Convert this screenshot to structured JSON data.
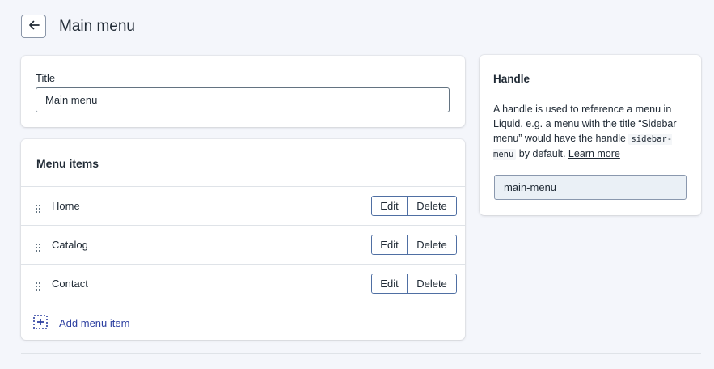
{
  "header": {
    "title": "Main menu",
    "back_icon": "arrow-left-icon"
  },
  "title_card": {
    "label": "Title",
    "value": "Main menu"
  },
  "menu_card": {
    "heading": "Menu items",
    "items": [
      {
        "label": "Home",
        "edit": "Edit",
        "delete": "Delete"
      },
      {
        "label": "Catalog",
        "edit": "Edit",
        "delete": "Delete"
      },
      {
        "label": "Contact",
        "edit": "Edit",
        "delete": "Delete"
      }
    ],
    "add_label": "Add menu item"
  },
  "handle_card": {
    "heading": "Handle",
    "desc_part1": "A handle is used to reference a menu in Liquid. e.g. a menu with the title “Sidebar menu” would have the handle ",
    "desc_code": "sidebar-menu",
    "desc_part2": " by default. ",
    "learn_more": "Learn more",
    "value": "main-menu"
  },
  "colors": {
    "link": "#2c3fa0",
    "border": "#4f6fa3",
    "background": "#f4f6fb"
  }
}
